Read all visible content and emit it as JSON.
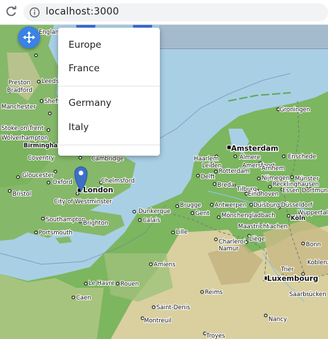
{
  "browser": {
    "url": "localhost:3000"
  },
  "menu": {
    "items": [
      "Europe",
      "France",
      "Germany",
      "Italy"
    ]
  },
  "map": {
    "cities": [
      "London",
      "Amsterdam",
      "Luxembourg"
    ],
    "places": [
      "Preston",
      "Leeds",
      "Bradford",
      "Manchester",
      "Sheffield",
      "Stoke-on-Trent",
      "Wolverhampton",
      "Birmingham",
      "Coventry",
      "Cambridge",
      "Gloucester",
      "Oxford",
      "Bristol",
      "City of Westminster",
      "Chelmsford",
      "Southampton",
      "Brighton",
      "Portsmouth",
      "Groningen",
      "Haarlem",
      "Almere",
      "Leiden",
      "Amersfoort",
      "Enschede",
      "Rotterdam",
      "Arnhem",
      "Delft",
      "Nijmegen",
      "Münster",
      "Breda",
      "Tilburg",
      "Recklinghausen",
      "Eindhoven",
      "Essen",
      "Dortmund",
      "Antwerpen",
      "Duisburg",
      "Düsseldorf",
      "Brugge",
      "Gent",
      "Mönchengladbach",
      "Wuppertal",
      "Dunkerque",
      "Calais",
      "Lille",
      "Aachen",
      "Köln",
      "Maastricht",
      "Charleroi",
      "Liège",
      "Namur",
      "Bonn",
      "Amiens",
      "Le Havre",
      "Rouen",
      "Caen",
      "Reims",
      "Saint-Denis",
      "Trier",
      "Saarbrücken",
      "Nancy",
      "Montreuil",
      "Troyes",
      "Koblenz"
    ],
    "water_labels": [
      "England"
    ]
  },
  "colors": {
    "sea": "#a9cfe5",
    "lowland": "#77b55c",
    "upland": "#d8cfa4",
    "accent": "#3b82e4"
  }
}
